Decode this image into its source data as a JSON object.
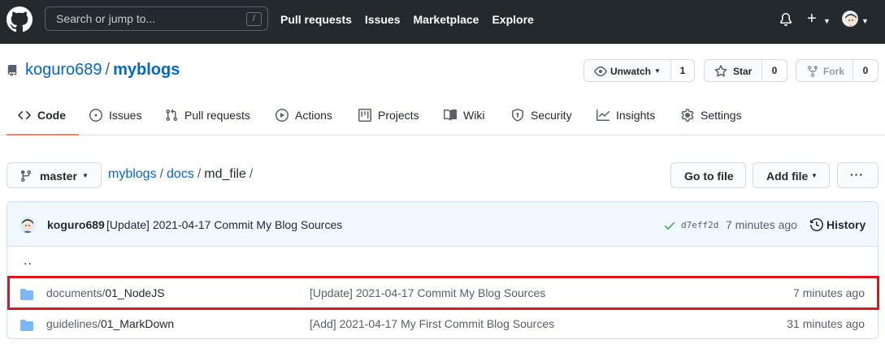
{
  "header": {
    "search_placeholder": "Search or jump to...",
    "search_shortcut": "/",
    "nav": [
      "Pull requests",
      "Issues",
      "Marketplace",
      "Explore"
    ],
    "new_label": "+"
  },
  "repo": {
    "owner": "koguro689",
    "separator": "/",
    "name": "myblogs",
    "watch_label": "Unwatch",
    "watch_count": "1",
    "star_label": "Star",
    "star_count": "0",
    "fork_label": "Fork",
    "fork_count": "0"
  },
  "tabs": [
    {
      "label": "Code",
      "icon": "code-icon",
      "selected": true
    },
    {
      "label": "Issues",
      "icon": "issue-icon"
    },
    {
      "label": "Pull requests",
      "icon": "pull-request-icon"
    },
    {
      "label": "Actions",
      "icon": "play-icon"
    },
    {
      "label": "Projects",
      "icon": "project-icon"
    },
    {
      "label": "Wiki",
      "icon": "book-icon"
    },
    {
      "label": "Security",
      "icon": "shield-icon"
    },
    {
      "label": "Insights",
      "icon": "graph-icon"
    },
    {
      "label": "Settings",
      "icon": "gear-icon"
    }
  ],
  "toolbar": {
    "branch": "master",
    "breadcrumb": {
      "root": "myblogs",
      "dir": "docs",
      "current": "md_file",
      "sep": "/"
    },
    "go_to_file": "Go to file",
    "add_file": "Add file",
    "more": "···"
  },
  "commit": {
    "author": "koguro689",
    "message": "[Update] 2021-04-17 Commit My Blog Sources",
    "sha": "d7eff2d",
    "time": "7 minutes ago",
    "history_label": "History"
  },
  "files": {
    "parent": "..",
    "rows": [
      {
        "dir": "documents/",
        "leaf": "01_NodeJS",
        "message": "[Update] 2021-04-17 Commit My Blog Sources",
        "age": "7 minutes ago",
        "highlighted": true
      },
      {
        "dir": "guidelines/",
        "leaf": "01_MarkDown",
        "message": "[Add] 2021-04-17 My First Commit Blog Sources",
        "age": "31 minutes ago"
      }
    ]
  },
  "colors": {
    "header_bg": "#24292e",
    "link": "#0366d6",
    "selected_tab_underline": "#f9826c",
    "folder": "#79b8ff",
    "commit_bar": "#f1f8ff",
    "highlight": "#e0161a",
    "success": "#28a745"
  }
}
